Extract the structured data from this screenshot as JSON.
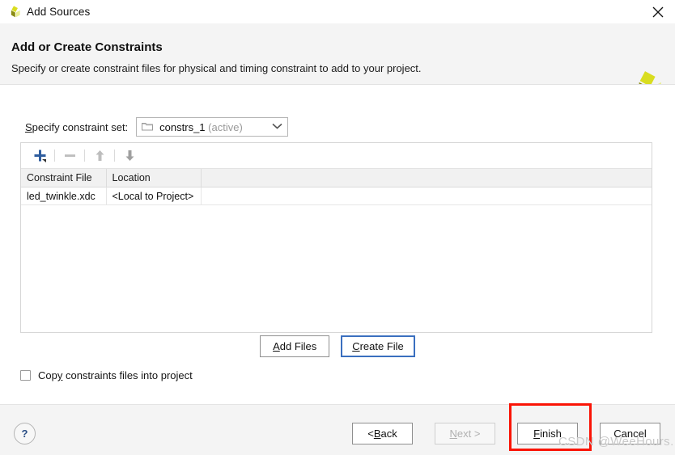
{
  "window": {
    "title": "Add Sources",
    "app_icon": "xilinx-logo-icon",
    "close_icon": "close-icon"
  },
  "header": {
    "title": "Add or Create Constraints",
    "subtitle": "Specify or create constraint files for physical and timing constraint to add to your project.",
    "logo_icon": "xilinx-logo-icon"
  },
  "constraint_set": {
    "label_prefix": "S",
    "label_rest": "pecify constraint set:",
    "folder_icon": "folder-icon",
    "value": "constrs_1",
    "state": "(active)",
    "chevron_icon": "chevron-down-icon"
  },
  "toolbar": {
    "add_icon": "plus-icon",
    "remove_icon": "minus-icon",
    "move_up_icon": "arrow-up-icon",
    "move_down_icon": "arrow-down-icon"
  },
  "table": {
    "columns": [
      "Constraint File",
      "Location",
      ""
    ],
    "rows": [
      {
        "file": "led_twinkle.xdc",
        "location": "<Local to Project>",
        "blank": ""
      }
    ]
  },
  "mid_buttons": {
    "add_files_prefix": "A",
    "add_files_rest": "dd Files",
    "create_file_prefix": "C",
    "create_file_rest": "reate File"
  },
  "copy_option": {
    "prefix": "Cop",
    "mnemonic": "y",
    "rest": " constraints files into project",
    "checked": false
  },
  "footer": {
    "help_icon": "question-mark-icon",
    "help_label": "?",
    "back_prefix": "< ",
    "back_mnemonic": "B",
    "back_rest": "ack",
    "next_prefix": "",
    "next_mnemonic": "N",
    "next_rest": "ext >",
    "finish_mnemonic": "F",
    "finish_rest": "inish",
    "cancel_label": "Cancel"
  },
  "annotation": {
    "highlight_color": "#fa1406",
    "target": "finish-button"
  },
  "watermark": {
    "text": "CSDN @WeeHours."
  }
}
